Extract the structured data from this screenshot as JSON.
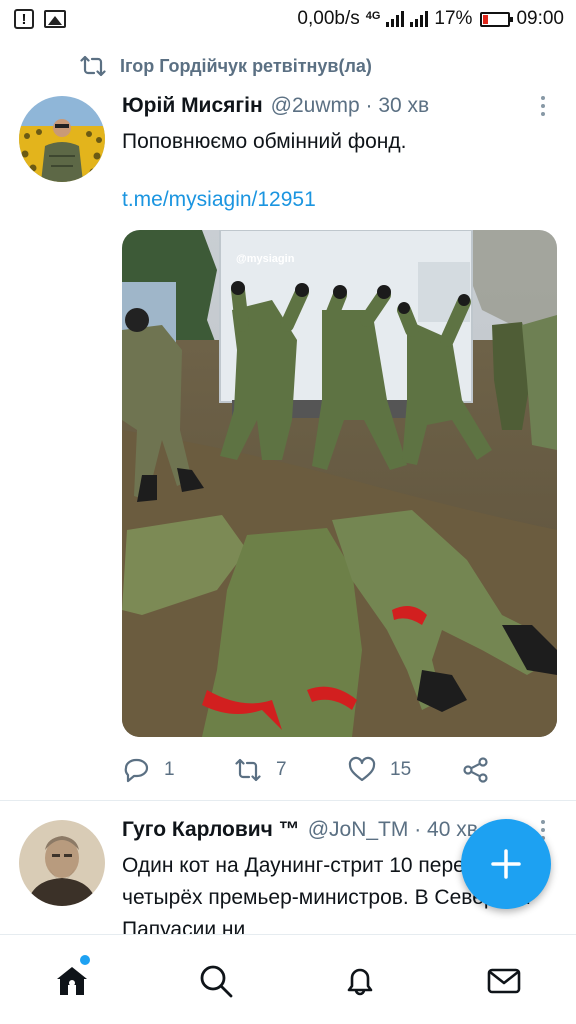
{
  "status_bar": {
    "network_speed": "0,00b/s",
    "network_type": "4G",
    "battery_percent": "17%",
    "time": "09:00"
  },
  "retweet_notice": "Ігор Гордійчук ретвітнув(ла)",
  "tweet": {
    "author_name": "Юрій Мисягін",
    "author_handle": "@2uwmp · 30 хв",
    "text": "Поповнюємо обмінний фонд.",
    "link": "t.me/mysiagin/12951",
    "media_watermark": "@mysiagin",
    "reply_count": "1",
    "retweet_count": "7",
    "like_count": "15"
  },
  "next_tweet": {
    "author_name": "Гуго Карлович ™",
    "author_handle": "@JoN_TM · 40 хв",
    "text": "Один кот на Даунинг-стрит 10 пережил четырёх премьер-министров. В Северной Папуасии ни"
  },
  "icons": {
    "retweet": "retweet-icon",
    "reply": "reply-icon",
    "like": "heart-icon",
    "share": "share-icon",
    "compose": "plus-icon",
    "home": "home-icon",
    "search": "search-icon",
    "notifications": "bell-icon",
    "messages": "mail-icon"
  },
  "colors": {
    "accent": "#1da1f2",
    "link": "#1b95e0",
    "secondary_text": "#5b7083"
  }
}
